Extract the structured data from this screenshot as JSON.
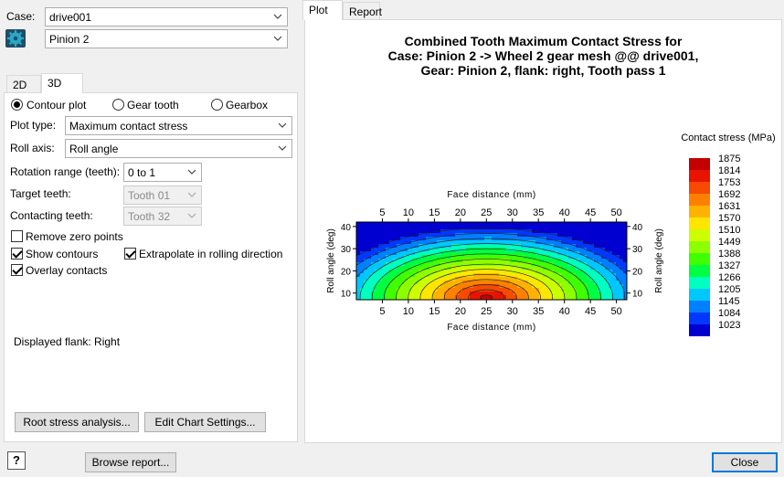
{
  "left": {
    "case_label": "Case:",
    "case_value": "drive001",
    "gear_value": "Pinion 2",
    "tabs": [
      {
        "label": "2D"
      },
      {
        "label": "3D"
      }
    ],
    "view_options": [
      {
        "label": "Contour plot",
        "selected": true
      },
      {
        "label": "Gear tooth",
        "selected": false
      },
      {
        "label": "Gearbox",
        "selected": false
      }
    ],
    "plot_type_label": "Plot type:",
    "plot_type_value": "Maximum contact stress",
    "roll_axis_label": "Roll axis:",
    "roll_axis_value": "Roll angle",
    "rotation_range_label": "Rotation range (teeth):",
    "rotation_range_value": "0 to  1",
    "target_teeth_label": "Target teeth:",
    "target_teeth_value": "Tooth 01",
    "contacting_teeth_label": "Contacting teeth:",
    "contacting_teeth_value": "Tooth 32",
    "checkboxes": {
      "remove_zero": {
        "label": "Remove zero points",
        "checked": false
      },
      "show_contours": {
        "label": "Show contours",
        "checked": true
      },
      "extrapolate": {
        "label": "Extrapolate in rolling direction",
        "checked": true
      },
      "overlay_contacts": {
        "label": "Overlay contacts",
        "checked": true
      }
    },
    "displayed_flank": "Displayed flank: Right",
    "root_stress_button": "Root stress analysis...",
    "edit_chart_button": "Edit Chart Settings..."
  },
  "right_tabs": [
    {
      "label": "Plot"
    },
    {
      "label": "Report"
    }
  ],
  "footer": {
    "help_icon": "?",
    "browse_button": "Browse report...",
    "close_button": "Close"
  },
  "chart_data": {
    "type": "heatmap",
    "title_lines": [
      "Combined Tooth Maximum Contact Stress for",
      "Case: Pinion 2 -> Wheel 2 gear mesh @@ drive001,",
      "Gear: Pinion 2, flank: right, Tooth pass 1"
    ],
    "xlabel": "Face distance (mm)",
    "ylabel": "Roll angle (deg)",
    "x_ticks": [
      5,
      10,
      15,
      20,
      25,
      30,
      35,
      40,
      45,
      50
    ],
    "y_ticks": [
      10,
      20,
      30,
      40
    ],
    "xlim": [
      0,
      52
    ],
    "ylim": [
      7,
      42
    ],
    "legend_title": "Contact stress (MPa)",
    "legend_levels": [
      1875,
      1814,
      1753,
      1692,
      1631,
      1570,
      1510,
      1449,
      1388,
      1327,
      1266,
      1205,
      1145,
      1084,
      1023
    ],
    "legend_colors": [
      "#c40000",
      "#e81400",
      "#f54a00",
      "#ff8000",
      "#ffb300",
      "#ffe600",
      "#ccff00",
      "#8cff00",
      "#40ff00",
      "#00ff40",
      "#00ffc0",
      "#00c8ff",
      "#0080ff",
      "#0038ff",
      "#0000d0"
    ],
    "peak": {
      "x": 25,
      "y": 8,
      "value": 1875
    },
    "grid": false,
    "legend_position": "right"
  }
}
